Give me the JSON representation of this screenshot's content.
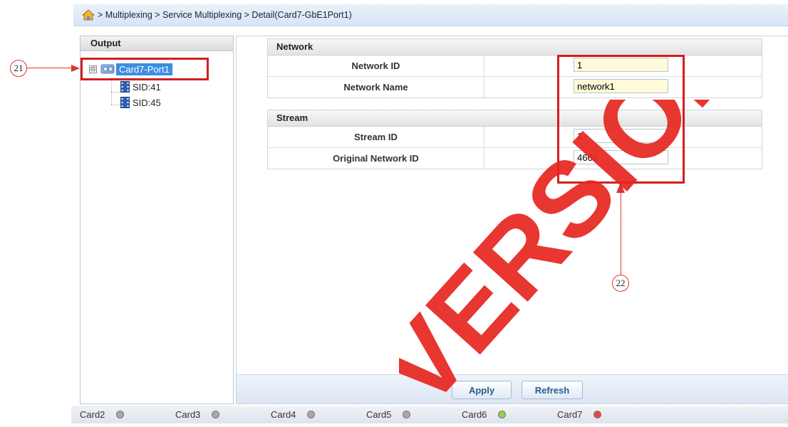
{
  "breadcrumb": {
    "text": "> Multiplexing > Service Multiplexing > Detail(Card7-GbE1Port1)"
  },
  "output_panel": {
    "title": "Output",
    "root": {
      "label": "Card7-Port1",
      "toggle": "⊟",
      "icon": "network-node-icon"
    },
    "children": [
      {
        "label": "SID:41",
        "icon": "film-icon"
      },
      {
        "label": "SID:45",
        "icon": "film-icon"
      }
    ]
  },
  "network": {
    "title": "Network",
    "rows": [
      {
        "label": "Network ID",
        "value": "1"
      },
      {
        "label": "Network Name",
        "value": "network1"
      }
    ]
  },
  "stream": {
    "title": "Stream",
    "rows": [
      {
        "label": "Stream ID",
        "value": "1"
      },
      {
        "label": "Original Network ID",
        "value": "4660"
      }
    ]
  },
  "buttons": {
    "apply": "Apply",
    "refresh": "Refresh"
  },
  "status_bar": {
    "cards": [
      {
        "label": "Card2",
        "status": "grey"
      },
      {
        "label": "Card3",
        "status": "grey"
      },
      {
        "label": "Card4",
        "status": "grey"
      },
      {
        "label": "Card5",
        "status": "grey"
      },
      {
        "label": "Card6",
        "status": "green"
      },
      {
        "label": "Card7",
        "status": "red"
      }
    ]
  },
  "annotations": {
    "callout_21": "21",
    "callout_22": "22"
  },
  "watermark": {
    "text": "VERSION"
  },
  "colors": {
    "accent": "#3b8ee0",
    "annotation_red": "#d21f1f",
    "status_grey": "#a8a8a8",
    "status_green": "#8fd14f",
    "status_red": "#e8463c"
  }
}
